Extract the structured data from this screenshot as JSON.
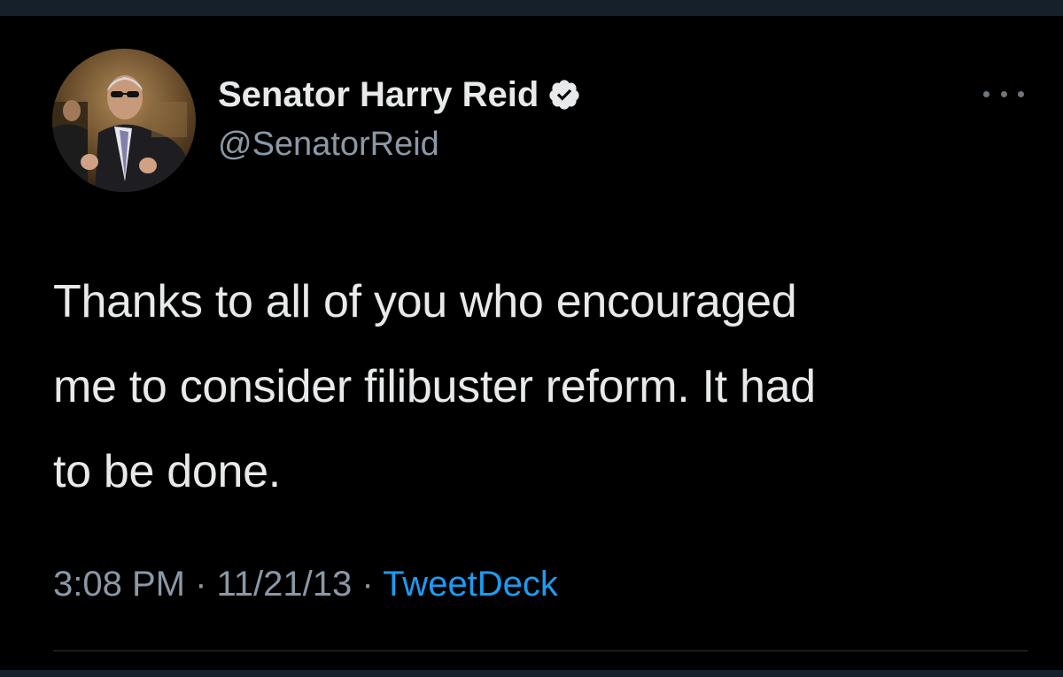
{
  "tweet": {
    "author": {
      "display_name": "Senator Harry Reid",
      "handle": "@SenatorReid",
      "verified": true,
      "avatar_icon": "profile-photo"
    },
    "text": "Thanks to all of you who encouraged\nme to consider filibuster reform. It had\nto be done.",
    "time": "3:08 PM",
    "date": "11/21/13",
    "separator": " · ",
    "source": "TweetDeck"
  },
  "colors": {
    "background": "#000000",
    "frame": "#15202b",
    "primary_text": "#e7e9ea",
    "secondary_text": "#8b98a5",
    "link": "#1d9bf0",
    "verified_badge": "#e7e9ea"
  },
  "icons": {
    "verified": "verified-badge-icon",
    "more": "more-horizontal-icon"
  }
}
